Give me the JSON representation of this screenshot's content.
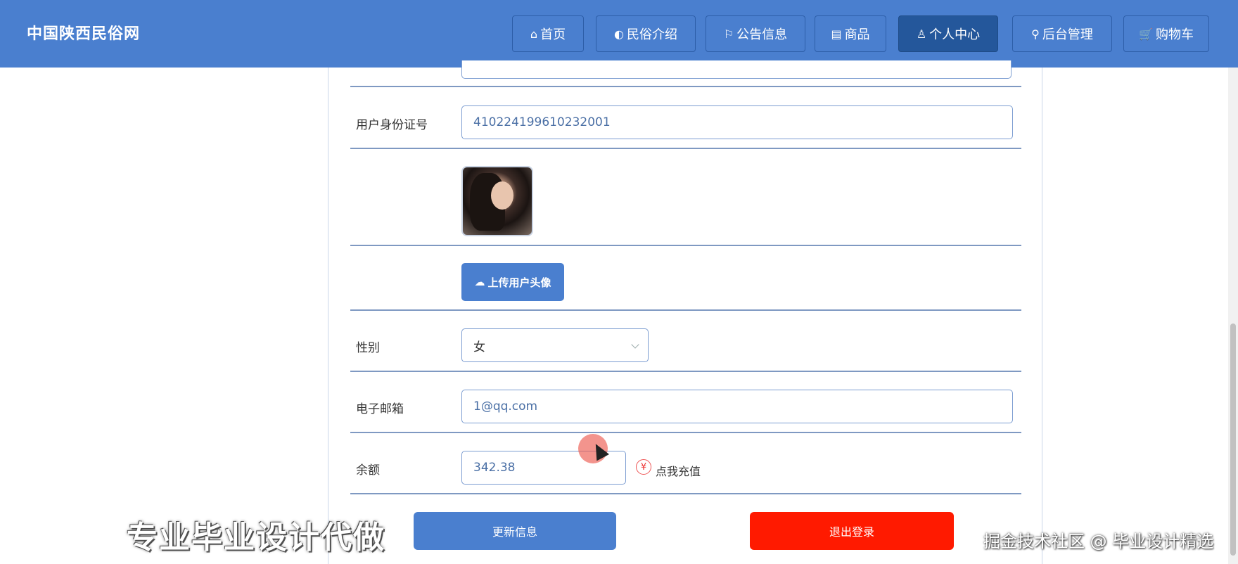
{
  "header": {
    "brand": "中国陕西民俗网",
    "nav": [
      {
        "icon": "home-icon",
        "glyph": "⌂",
        "label": "首页"
      },
      {
        "icon": "palette-icon",
        "glyph": "◐",
        "label": "民俗介绍"
      },
      {
        "icon": "flag-icon",
        "glyph": "⚐",
        "label": "公告信息"
      },
      {
        "icon": "calendar-icon",
        "glyph": "▤",
        "label": "商品"
      },
      {
        "icon": "user-icon",
        "glyph": "♙",
        "label": "个人中心"
      },
      {
        "icon": "link-icon",
        "glyph": "⚲",
        "label": "后台管理"
      },
      {
        "icon": "cart-icon",
        "glyph": "🛒",
        "label": "购物车"
      }
    ]
  },
  "form": {
    "id_label": "用户身份证号",
    "id_value": "410224199610232001",
    "upload_label": "上传用户头像",
    "gender_label": "性别",
    "gender_value": "女",
    "email_label": "电子邮箱",
    "email_value": "1@qq.com",
    "balance_label": "余额",
    "balance_value": "342.38",
    "yen_glyph": "¥",
    "recharge_label": "点我充值",
    "update_button": "更新信息",
    "logout_button": "退出登录"
  },
  "watermarks": {
    "left": "专业毕业设计代做",
    "right": "掘金技术社区 @ 毕业设计精选"
  }
}
